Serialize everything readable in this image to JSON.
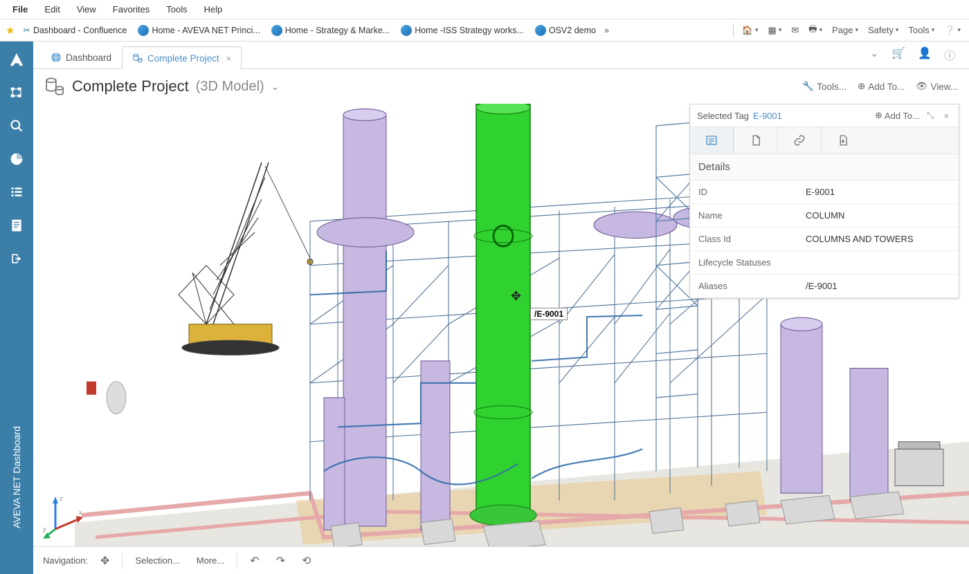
{
  "menubar": {
    "items": [
      "File",
      "Edit",
      "View",
      "Favorites",
      "Tools",
      "Help"
    ]
  },
  "bookmarks": {
    "items": [
      {
        "label": "Dashboard - Confluence",
        "icon": "scissors"
      },
      {
        "label": "Home - AVEVA NET Princi...",
        "icon": "ie"
      },
      {
        "label": "Home - Strategy & Marke...",
        "icon": "ie"
      },
      {
        "label": "Home -ISS Strategy works...",
        "icon": "ie"
      },
      {
        "label": "OSV2 demo",
        "icon": "ie"
      }
    ],
    "tools": [
      "Page",
      "Safety",
      "Tools"
    ]
  },
  "sidebar": {
    "vertical_label": "AVEVA NET Dashboard"
  },
  "tabs": {
    "items": [
      {
        "label": "Dashboard",
        "active": false
      },
      {
        "label": "Complete Project",
        "active": true
      }
    ]
  },
  "header": {
    "title": "Complete Project",
    "subtitle": "(3D Model)",
    "actions": {
      "tools": "Tools...",
      "add": "Add To...",
      "view": "View..."
    }
  },
  "scene": {
    "selected_label": "/E-9001"
  },
  "details": {
    "title_label": "Selected Tag",
    "title_value": "E-9001",
    "add_label": "Add To...",
    "section": "Details",
    "rows": [
      {
        "k": "ID",
        "v": "E-9001"
      },
      {
        "k": "Name",
        "v": "COLUMN"
      },
      {
        "k": "Class Id",
        "v": "COLUMNS AND TOWERS"
      },
      {
        "k": "Lifecycle Statuses",
        "v": ""
      },
      {
        "k": "Aliases",
        "v": "/E-9001"
      }
    ]
  },
  "bottombar": {
    "navigation": "Navigation:",
    "selection": "Selection...",
    "more": "More..."
  }
}
